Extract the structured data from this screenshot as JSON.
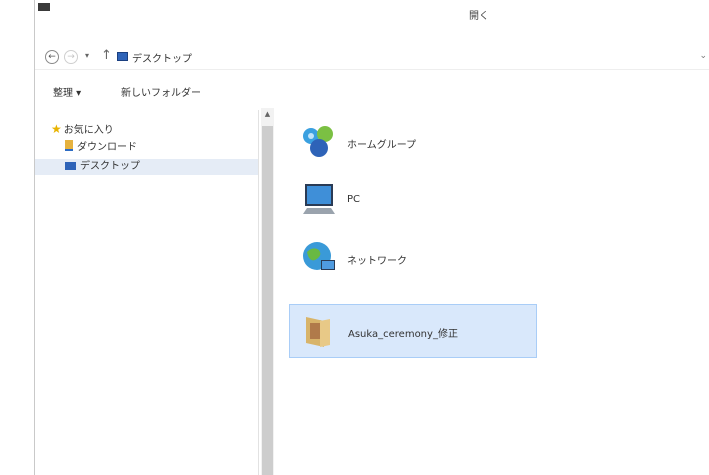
{
  "window": {
    "title": "開く"
  },
  "address": {
    "breadcrumb": "デスクトップ"
  },
  "toolbar": {
    "organize": "整理 ▾",
    "new_folder": "新しいフォルダー"
  },
  "nav": {
    "favorites": "お気に入り",
    "items": [
      {
        "label": "ダウンロード"
      },
      {
        "label": "デスクトップ",
        "selected": true
      }
    ]
  },
  "content": {
    "items": [
      {
        "label": "ホームグループ",
        "icon": "homegroup-icon"
      },
      {
        "label": "PC",
        "icon": "pc-icon"
      },
      {
        "label": "ネットワーク",
        "icon": "network-icon"
      },
      {
        "label": "Asuka_ceremony_修正",
        "icon": "folder-icon",
        "selected": true
      }
    ]
  },
  "colors": {
    "selection_bg": "#d9e8fb",
    "selection_border": "#a9cdf7",
    "accent": "#2e63b8"
  }
}
